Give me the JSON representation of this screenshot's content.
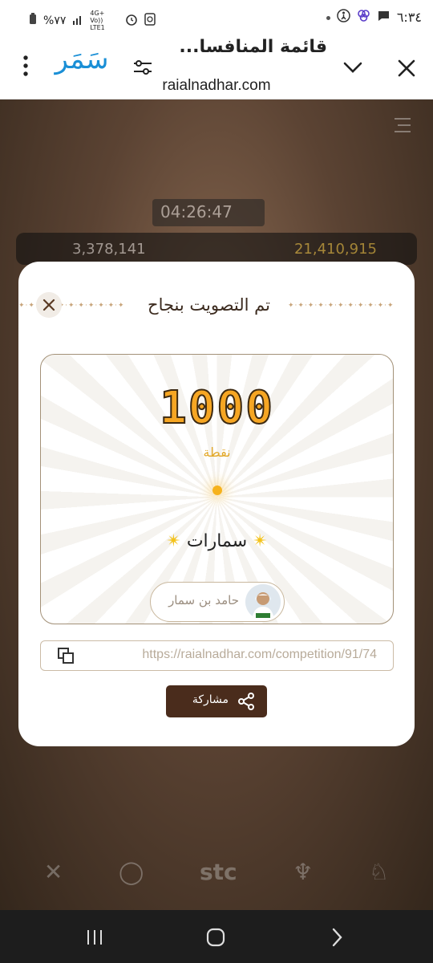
{
  "status_bar": {
    "time": "٦:٣٤",
    "battery": "%٧٧",
    "network": "4G+ Vo)) LTE1"
  },
  "browser": {
    "page_title": "قائمة المنافسا...",
    "url": "raialnadhar.com",
    "brand": "سَمَر"
  },
  "modal": {
    "title": "تم التصويت بنجاح",
    "points": "1000",
    "points_label": "نقطة",
    "entry_name": "سمارات",
    "author": "حامد بن سمار",
    "share_url": "https://raialnadhar.com/competition/91/74",
    "share_label": "مشاركة"
  },
  "background": {
    "timer": "04:26:47",
    "left_count": "3,378,141",
    "right_count": "21,410,915"
  },
  "colors": {
    "accent": "#f6a623",
    "brand_brown": "#4a2c1c",
    "brand_blue": "#1a8fd6"
  }
}
